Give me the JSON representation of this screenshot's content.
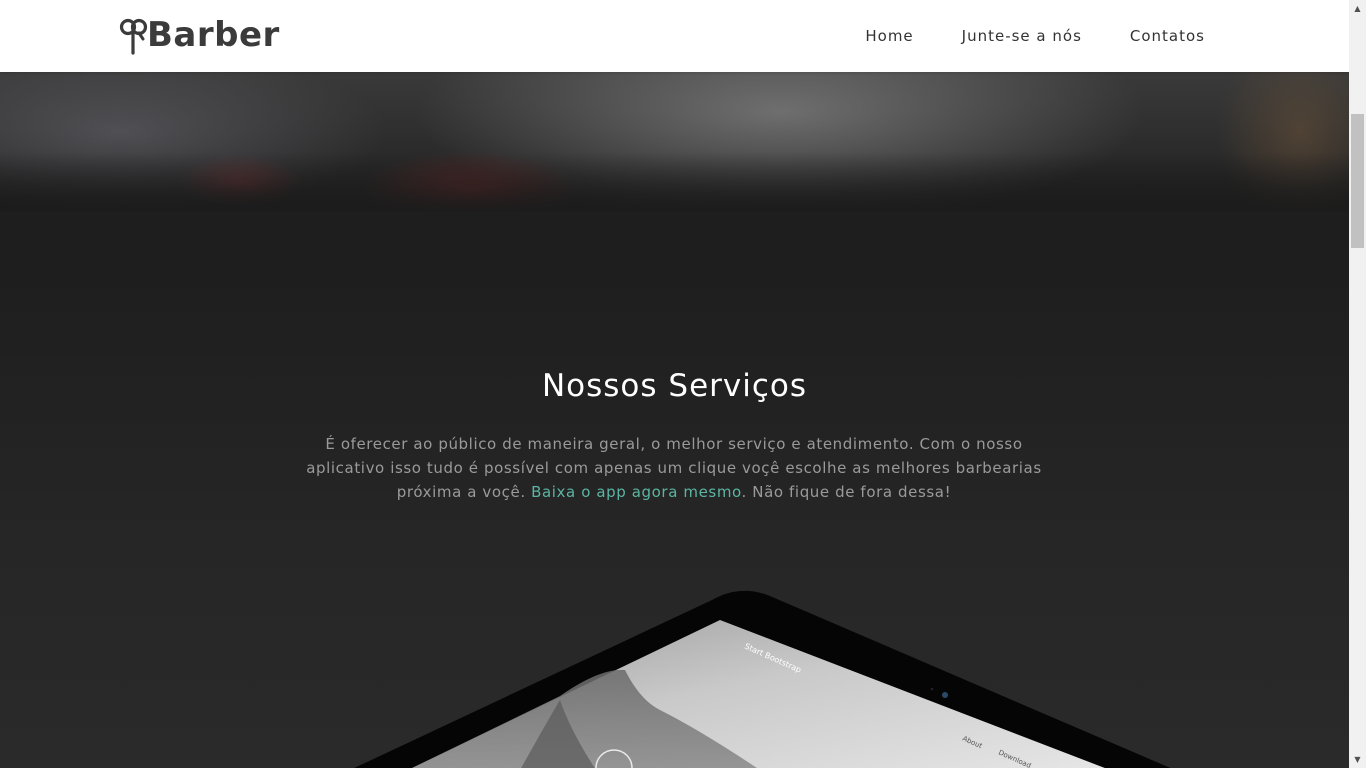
{
  "navbar": {
    "brand": "Barber",
    "links": [
      {
        "label": "Home"
      },
      {
        "label": "Junte-se a nós"
      },
      {
        "label": "Contatos"
      }
    ]
  },
  "services": {
    "title": "Nossos Serviços",
    "text_before": "É oferecer ao público de maneira geral, o melhor serviço e atendimento. Com o nosso aplicativo isso tudo é possível com apenas um clique voçê escolhe as melhores barbearias próxima a voçê. ",
    "link_text": "Baixa o app agora mesmo",
    "text_after": ". Não fique de fora dessa!",
    "link_color": "#5bb5a2"
  },
  "tablet_screen": {
    "brand": "Start Bootstrap",
    "menu": [
      "About",
      "Download"
    ]
  },
  "colors": {
    "background": "#222222",
    "title": "#ffffff",
    "body_text": "#9a9a9a",
    "navbar_bg": "#ffffff"
  }
}
